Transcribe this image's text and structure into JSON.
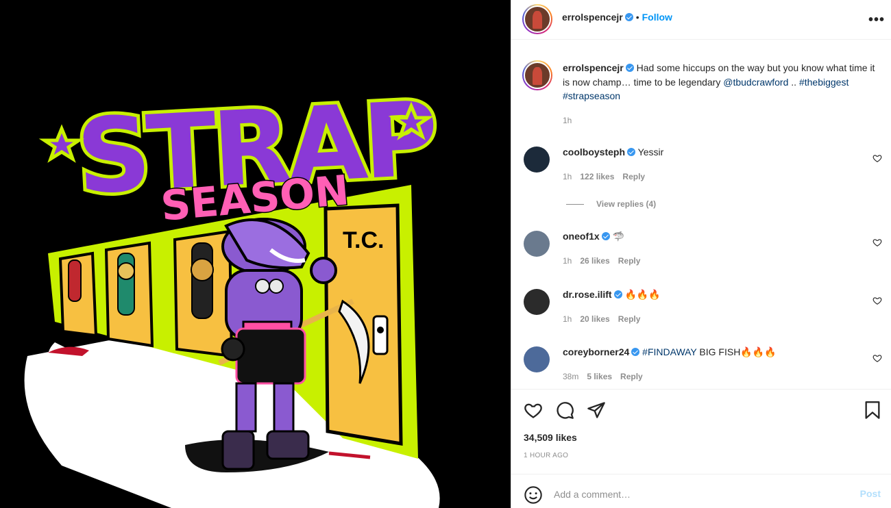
{
  "post": {
    "image": {
      "artwork_title": "STRAP",
      "artwork_subtitle": "SEASON",
      "door_label": "T.C."
    }
  },
  "header": {
    "username": "errolspencejr",
    "separator": "•",
    "follow_label": "Follow",
    "more_label": "•••"
  },
  "caption": {
    "username": "errolspencejr",
    "text_before": "Had some hiccups on the way but you know what time it is now champ… time to be legendary ",
    "mention": "@tbudcrawford",
    "text_after": " ..",
    "hashtag1": "#thebiggest",
    "hashtag2": "#strapseason",
    "time": "1h"
  },
  "comments": [
    {
      "username": "coolboysteph",
      "text": "Yessir",
      "time": "1h",
      "likes": "122 likes",
      "reply_label": "Reply",
      "view_replies": "View replies (4)"
    },
    {
      "username": "oneof1x",
      "text": "🦈",
      "time": "1h",
      "likes": "26 likes",
      "reply_label": "Reply"
    },
    {
      "username": "dr.rose.ilift",
      "text": "🔥🔥🔥",
      "time": "1h",
      "likes": "20 likes",
      "reply_label": "Reply"
    },
    {
      "username": "coreyborner24",
      "hashtag": "#FINDAWAY",
      "text": " BIG FISH🔥🔥🔥",
      "time": "38m",
      "likes": "5 likes",
      "reply_label": "Reply"
    }
  ],
  "actions": {
    "likes_count": "34,509 likes",
    "time_ago": "1 HOUR AGO"
  },
  "composer": {
    "placeholder": "Add a comment…",
    "post_label": "Post"
  },
  "colors": {
    "accent": "#0095f6",
    "verified": "#3897f0",
    "link": "#00376b",
    "muted": "#8e8e8e",
    "post_disabled": "#b2dffc"
  }
}
